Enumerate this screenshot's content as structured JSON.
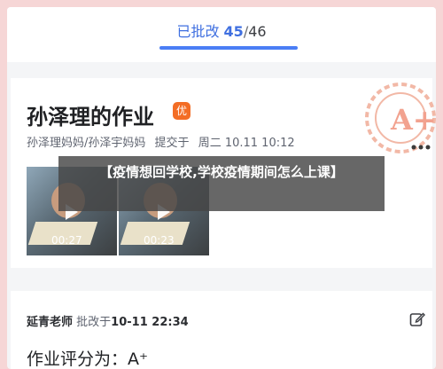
{
  "header": {
    "approved_label": "已批改",
    "approved_count": "45",
    "separator": "/",
    "total_count": "46"
  },
  "homework": {
    "title": "孙泽理的作业",
    "badge": "优",
    "submitters": "孙泽理妈妈/孙泽宇妈妈",
    "submitted_label": "提交于",
    "submitted_time": "周二 10.11 10:12",
    "stamp_text": "A+"
  },
  "videos": [
    {
      "duration": "00:27"
    },
    {
      "duration": "00:23"
    }
  ],
  "banner": {
    "text": "【疫情想回学校,学校疫情期间怎么上课】"
  },
  "review": {
    "teacher": "延青老师",
    "reviewed_label": "批改于",
    "reviewed_time": "10-11 22:34",
    "grade_label": "作业评分为：",
    "grade_value": "A⁺"
  },
  "colors": {
    "accent": "#4a7ef5",
    "badge": "#f36d25",
    "stamp": "#f2b8a6"
  },
  "icons": [
    "play-icon",
    "edit-icon",
    "grade-stamp-icon"
  ]
}
